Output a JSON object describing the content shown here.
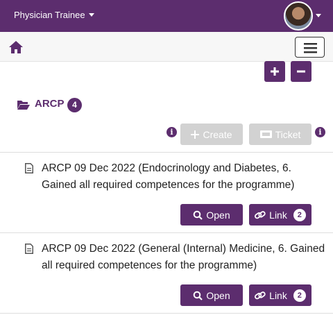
{
  "header": {
    "role_label": "Physician Trainee",
    "avatar_alt": "User avatar"
  },
  "colors": {
    "brand": "#5c2d6e",
    "disabled": "#d2d2d2"
  },
  "section": {
    "title": "ARCP",
    "count": "4",
    "create_label": "Create",
    "ticket_label": "Ticket"
  },
  "items": [
    {
      "text": "ARCP 09 Dec 2022 (Endocrinology and Diabetes, 6. Gained all required competences for the programme)",
      "open_label": "Open",
      "link_label": "Link",
      "link_count": "2"
    },
    {
      "text": "ARCP 09 Dec 2022 (General (Internal) Medicine, 6. Gained all required competences for the programme)",
      "open_label": "Open",
      "link_label": "Link",
      "link_count": "2"
    }
  ]
}
